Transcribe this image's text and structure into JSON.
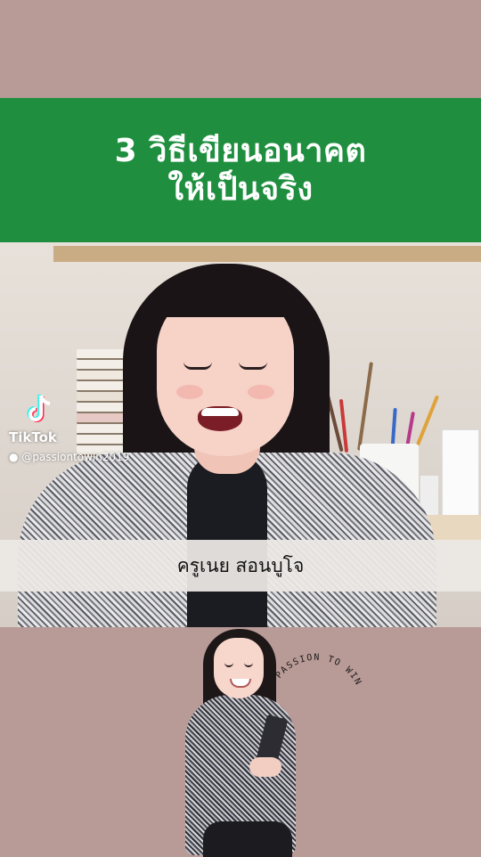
{
  "title": {
    "line1": "3 วิธีเขียนอนาคต",
    "line2": "ให้เป็นจริง"
  },
  "watermark": {
    "platform": "TikTok",
    "handle": "@passiontowin2019",
    "user_icon": "person-icon"
  },
  "caption": {
    "text": "ครูเนย สอนบูโจ"
  },
  "logo": {
    "text": "PASSION TO WIN"
  },
  "colors": {
    "background": "#b89a96",
    "banner": "#1f8f3f",
    "banner_text": "#ffffff",
    "caption_bar": "#ece8e4"
  }
}
